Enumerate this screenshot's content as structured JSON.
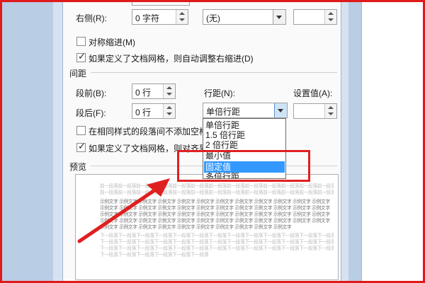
{
  "indent": {
    "right_label": "右侧(R):",
    "right_value": "0 字符",
    "special_value": "(无)",
    "special_by_value": "",
    "mirror_indent_label": "对称缩进(M)",
    "mirror_indent_checked": false,
    "auto_adjust_right_label": "如果定义了文档网格，则自动调整右缩进(D)",
    "auto_adjust_right_checked": true
  },
  "spacing": {
    "section_title": "间距",
    "before_label": "段前(B):",
    "before_value": "0 行",
    "after_label": "段后(F):",
    "after_value": "0 行",
    "line_spacing_label": "行距(N):",
    "line_spacing_value": "单倍行距",
    "at_label": "设置值(A):",
    "at_value": "",
    "no_space_same_style_label": "在相同样式的段落间不添加空格",
    "no_space_same_style_checked": false,
    "snap_grid_label": "如果定义了文档网格，则对齐到",
    "snap_grid_checked": true
  },
  "line_spacing_options": [
    {
      "label": "单倍行距",
      "selected": false
    },
    {
      "label": "1.5 倍行距",
      "selected": false
    },
    {
      "label": "2 倍行距",
      "selected": false
    },
    {
      "label": "最小值",
      "selected": false
    },
    {
      "label": "固定值",
      "selected": true
    },
    {
      "label": "多倍行距",
      "selected": false
    }
  ],
  "preview": {
    "section_title": "预览",
    "lines": [
      {
        "text": "前一段落前一段落前一段落前一段落前一段落前一段落前一段落前一段落前一段落前一段落前一段落前一段落前一段落前一段落",
        "style": "grey"
      },
      {
        "text": "前一段落前一段落前一段落前一段落前一段落前一段落前一段落前一段落前一段落前一段落前一段落前一段落前一段落前一段落",
        "style": "grey"
      },
      {
        "text": "示例文字 示例文字 示例文字 示例文字 示例文字 示例文字 示例文字 示例文字 示例文字 示例文字 示例文字 示例文字",
        "style": "dark"
      },
      {
        "text": "示例文字 示例文字 示例文字 示例文字 示例文字 示例文字 示例文字 示例文字 示例文字 示例文字 示例文字 示例文字",
        "style": "dark"
      },
      {
        "text": "示例文字 示例文字 示例文字 示例文字 示例文字 示例文字 示例文字 示例文字 示例文字 示例文字 示例文字 示例文字",
        "style": "dark"
      },
      {
        "text": "示例文字 示例文字 示例文字 示例文字 示例文字 示例文字 示例文字 示例文字 示例文字 示例文字 示例文字 示例文字",
        "style": "dark"
      },
      {
        "text": "示例文字 示例文字 示例文字 示例文字 示例文字 示例文字 示例文字 示例文字 示例文字 示例文字",
        "style": "dark"
      },
      {
        "text": "下一段落下一段落下一段落下一段落下一段落下一段落下一段落下一段落下一段落下一段落下一段落下一段落下一段落下一段落",
        "style": "grey"
      },
      {
        "text": "下一段落下一段落下一段落下一段落下一段落下一段落下一段落下一段落下一段落下一段落下一段落下一段落下一段落下一段落",
        "style": "grey"
      },
      {
        "text": "下一段落下一段落下一段落下一段落下一段落下一段落下一段落下一段落下一段落下一段落下一段落下一段落下一段落下一段落",
        "style": "grey"
      },
      {
        "text": "下一段落下一段落下一段落下一段落下一段落下一段落",
        "style": "grey"
      }
    ]
  },
  "annotation": {
    "highlight_color": "#e02020",
    "arrow_color": "#e02020",
    "frame_color": "#e01a1a"
  },
  "colors": {
    "selection": "#3399ff",
    "background_blue": "#b9cde5"
  }
}
